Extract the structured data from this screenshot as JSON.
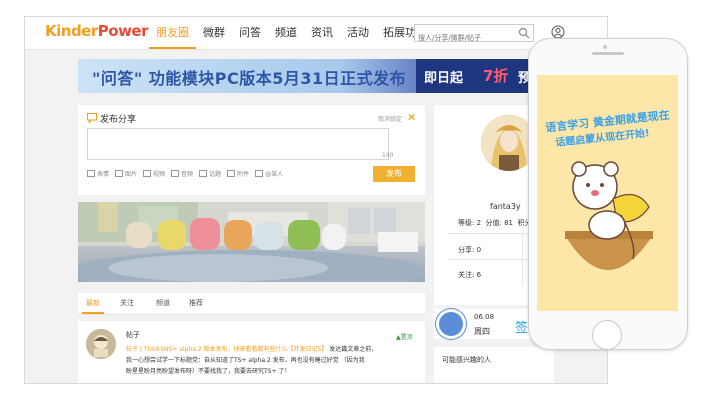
{
  "header": {
    "logo": "KinderPower",
    "nav": [
      "朋友圈",
      "微群",
      "问答",
      "频道",
      "资讯",
      "活动",
      "拓展功能"
    ],
    "search_placeholder": "搜人/分享/微群/帖子"
  },
  "banner": {
    "text": "\"问答\" 功能模块PC版本5月31日正式发布",
    "tag_a": "即日起",
    "tag_b": "7折",
    "tag_c": "预售"
  },
  "post": {
    "title": "发布分享",
    "tip": "取消锁定",
    "close": "✕",
    "count": "140",
    "tools": [
      "表情",
      "图片",
      "视频",
      "音频",
      "话题",
      "附件",
      "@某人"
    ],
    "submit": "发布"
  },
  "tabs": [
    "最新",
    "关注",
    "频道",
    "推荐"
  ],
  "feed": {
    "name": "帖子",
    "badge": "▲置顶",
    "highlight": "帖子 | ThinkSNS+ alpha.2 版本发布，快来看看都有些什么【开发日记5】",
    "line1_tail": "发达篇文章之前，",
    "line2": "我一心想尝试学一下标题党：自从知道了TS+ alpha.2 发布，再也没有睡过好觉 （因为我",
    "line3": "盼星星盼月亮盼望发布呀）不要找我了，我要去研究TS+ 了！"
  },
  "profile": {
    "name": "fanta3y",
    "level": "等级: 2",
    "score": "分值: 81",
    "fans": "积分",
    "share": "分享: 0",
    "fav": "收",
    "follow": "关注: 6",
    "fan2": "粉"
  },
  "weather": {
    "date": "06.08",
    "day": "周四",
    "signin": "签到"
  },
  "maybe": {
    "title": "可能感兴趣的人"
  },
  "phone": {
    "line1": "语言学习 黄金期就是现在",
    "line2": "话题启蒙从现在开始!"
  },
  "colors": {
    "accent": "#f0a020",
    "banner_blue": "#2d57a6",
    "sign_blue": "#2ca0e0"
  }
}
